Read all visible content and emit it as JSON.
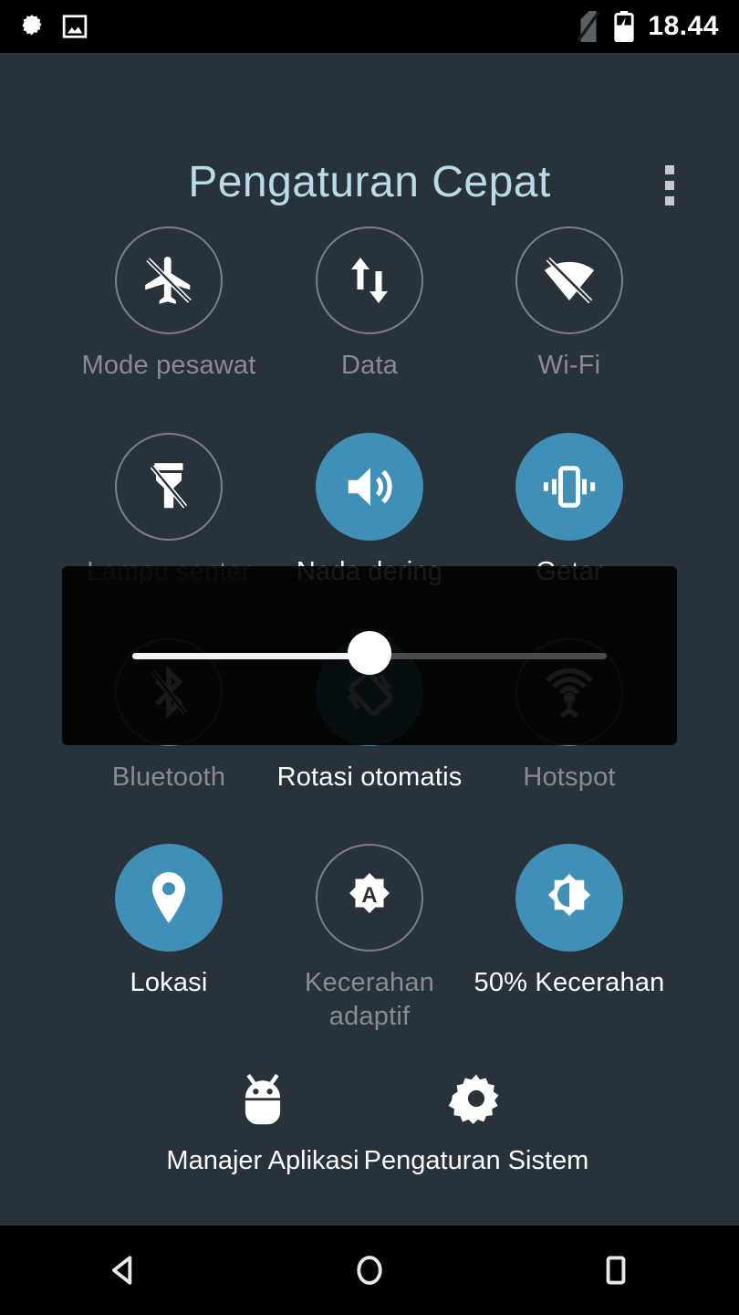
{
  "status_bar": {
    "left_icons": [
      {
        "name": "settings-flower-icon",
        "label": "settings"
      },
      {
        "name": "screenshot-image-icon",
        "label": "image"
      }
    ],
    "right_icons": [
      {
        "name": "no-sim-icon",
        "label": "no sim"
      },
      {
        "name": "battery-charging-icon",
        "label": "charging"
      }
    ],
    "time": "18.44"
  },
  "header": {
    "title": "Pengaturan Cepat",
    "overflow_label": "More options"
  },
  "colors": {
    "background": "#28323a",
    "accent_blue": "#3f8fb7",
    "title_blue": "#b9dbe8",
    "label_off": "#868e93",
    "label_on": "#ffffff",
    "status_bar": "#000000"
  },
  "tiles": [
    {
      "name": "airplane-mode",
      "icon": "airplane-off-icon",
      "label": "Mode pesawat",
      "active": false
    },
    {
      "name": "mobile-data",
      "icon": "data-arrows-icon",
      "label": "Data",
      "active": false
    },
    {
      "name": "wifi",
      "icon": "wifi-off-icon",
      "label": "Wi-Fi",
      "active": false
    },
    {
      "name": "flashlight",
      "icon": "flashlight-off-icon",
      "label": "Lampu senter",
      "active": false
    },
    {
      "name": "ringtone",
      "icon": "volume-up-icon",
      "label": "Nada dering",
      "active": true
    },
    {
      "name": "vibrate",
      "icon": "vibration-icon",
      "label": "Getar",
      "active": true
    },
    {
      "name": "bluetooth",
      "icon": "bluetooth-off-icon",
      "label": "Bluetooth",
      "active": false
    },
    {
      "name": "auto-rotate",
      "icon": "screen-rotation-icon",
      "label": "Rotasi otomatis",
      "active": true
    },
    {
      "name": "hotspot",
      "icon": "hotspot-icon",
      "label": "Hotspot",
      "active": false
    },
    {
      "name": "location",
      "icon": "location-pin-icon",
      "label": "Lokasi",
      "active": true
    },
    {
      "name": "adaptive-brightness",
      "icon": "auto-brightness-icon",
      "label": "Kecerahan adaptif",
      "active": false
    },
    {
      "name": "brightness",
      "icon": "brightness-icon",
      "label": "50% Kecerahan",
      "active": true
    }
  ],
  "shortcuts": [
    {
      "name": "app-manager",
      "icon": "android-robot-icon",
      "label": "Manajer Aplikasi"
    },
    {
      "name": "system-settings",
      "icon": "gear-icon",
      "label": "Pengaturan Sistem"
    }
  ],
  "slider": {
    "name": "brightness-slider",
    "value": 50,
    "min": 0,
    "max": 100,
    "value_label": "50%"
  },
  "nav_bar": {
    "back": "back-triangle-icon",
    "home": "home-circle-icon",
    "recents": "recents-square-icon"
  }
}
